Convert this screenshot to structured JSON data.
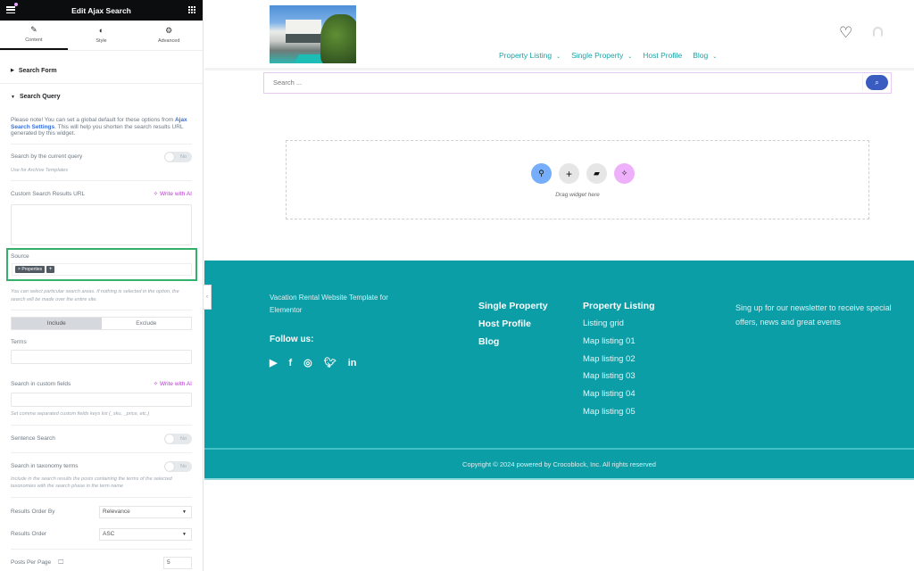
{
  "panel": {
    "title": "Edit Ajax Search",
    "tabs": [
      {
        "label": "Content",
        "icon": "pencil-icon",
        "active": true
      },
      {
        "label": "Style",
        "icon": "half-circle-icon",
        "active": false
      },
      {
        "label": "Advanced",
        "icon": "gear-icon",
        "active": false
      }
    ],
    "sections": {
      "search_form": "Search Form",
      "search_query": "Search Query"
    },
    "note": {
      "before": "Please note! You can set a global default for these options from ",
      "link": "Ajax Search Settings",
      "after": ". This will help you shorten the search results URL generated by this widget."
    },
    "current_query": {
      "label": "Search by the current query",
      "toggle": "No",
      "hint": "Use for Archive Templates"
    },
    "custom_url": {
      "label": "Custom Search Results URL",
      "ai": "Write with AI",
      "value": ""
    },
    "source": {
      "label": "Source",
      "chips": [
        "Properties"
      ],
      "chip_remove": "×",
      "add": "+",
      "hint": "You can select particular search areas. If nothing is selected in the option, the search will be made over the entire site."
    },
    "include_exclude": {
      "include": "Include",
      "exclude": "Exclude",
      "selected": "Include"
    },
    "terms": {
      "label": "Terms",
      "value": ""
    },
    "custom_fields": {
      "label": "Search in custom fields",
      "ai": "Write with AI",
      "value": "",
      "hint": "Set comma separated custom fields keys list (_sku, _price, etc.)"
    },
    "sentence_search": {
      "label": "Sentence Search",
      "toggle": "No"
    },
    "taxonomy_terms": {
      "label": "Search in taxonomy terms",
      "toggle": "No",
      "hint": "Include in the search results the posts containing the terms of the selected taxonomies with the search phase in the term name"
    },
    "order_by": {
      "label": "Results Order By",
      "value": "Relevance"
    },
    "order": {
      "label": "Results Order",
      "value": "ASC"
    },
    "per_page": {
      "label": "Posts Per Page",
      "value": "5"
    }
  },
  "site": {
    "nav": [
      {
        "label": "Property Listing",
        "dropdown": true
      },
      {
        "label": "Single Property",
        "dropdown": true
      },
      {
        "label": "Host Profile",
        "dropdown": false
      },
      {
        "label": "Blog",
        "dropdown": true
      }
    ],
    "search": {
      "placeholder": "Search ..."
    },
    "drop_zone": {
      "text": "Drag widget here"
    },
    "footer": {
      "description": "Vacation Rental Website Template for Elementor",
      "follow": "Follow us:",
      "social": [
        "youtube-icon",
        "facebook-icon",
        "instagram-icon",
        "twitter-icon",
        "linkedin-icon"
      ],
      "col1": [
        "Single Property",
        "Host Profile",
        "Blog"
      ],
      "col2_heading": "Property Listing",
      "col2": [
        "Listing grid",
        "Map listing 01",
        "Map listing 02",
        "Map listing 03",
        "Map listing 04",
        "Map listing 05"
      ],
      "newsletter": "Sing up for our newsletter to receive special offers, news and great events",
      "copyright": "Copyright © 2024 powered by Crocoblock, Inc. All rights reserved"
    }
  },
  "colors": {
    "accent_teal": "#0c9ea7",
    "nav_teal": "#1aa3a6",
    "search_button": "#3a5bbf",
    "ai_purple": "#c036d8",
    "source_highlight": "#35b06a"
  }
}
